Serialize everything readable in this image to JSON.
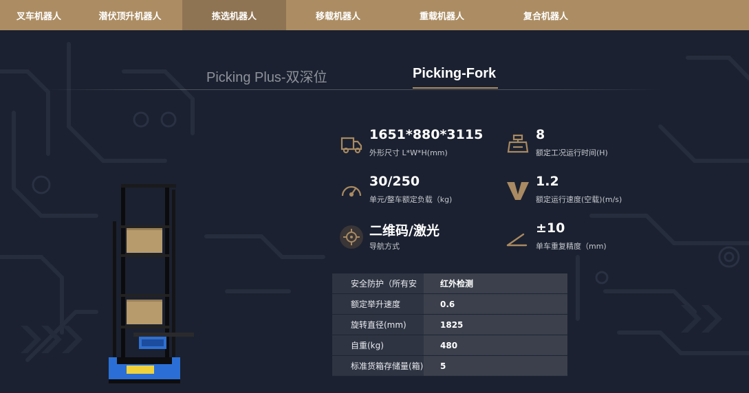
{
  "nav": {
    "items": [
      {
        "label": "叉车机器人",
        "active": false
      },
      {
        "label": "潜伏顶升机器人",
        "active": false
      },
      {
        "label": "拣选机器人",
        "active": true
      },
      {
        "label": "移载机器人",
        "active": false
      },
      {
        "label": "重载机器人",
        "active": false
      },
      {
        "label": "复合机器人",
        "active": false
      }
    ]
  },
  "tabs": [
    {
      "label": "Picking Plus-双深位",
      "active": false
    },
    {
      "label": "Picking-Fork",
      "active": true
    }
  ],
  "specs": [
    {
      "value": "1651*880*3115",
      "label": "外形尺寸 L*W*H(mm)",
      "icon": "truck-icon"
    },
    {
      "value": "8",
      "label": "额定工况运行时间(H)",
      "icon": "scale-icon"
    },
    {
      "value": "30/250",
      "label": "单元/整车额定负载（kg)",
      "icon": "gauge-icon"
    },
    {
      "value": "1.2",
      "label": "额定运行速度(空载)(m/s)",
      "icon": "speed-v-icon"
    },
    {
      "value": "二维码/激光",
      "label": "导航方式",
      "icon": "crosshair-icon"
    },
    {
      "value": "±10",
      "label": "单车重复精度（mm)",
      "icon": "angle-icon"
    }
  ],
  "table": {
    "rows": [
      {
        "name": "安全防护（所有安",
        "value": "红外检测"
      },
      {
        "name": "额定举升速度",
        "value": "0.6"
      },
      {
        "name": "旋转直径(mm)",
        "value": "1825"
      },
      {
        "name": "自重(kg)",
        "value": "480"
      },
      {
        "name": "标准货箱存储量(箱)",
        "value": "5"
      }
    ]
  },
  "colors": {
    "accent": "#ac8d63",
    "accent_active": "#8f7453",
    "background": "#1b2130",
    "icon": "#a98a62"
  }
}
